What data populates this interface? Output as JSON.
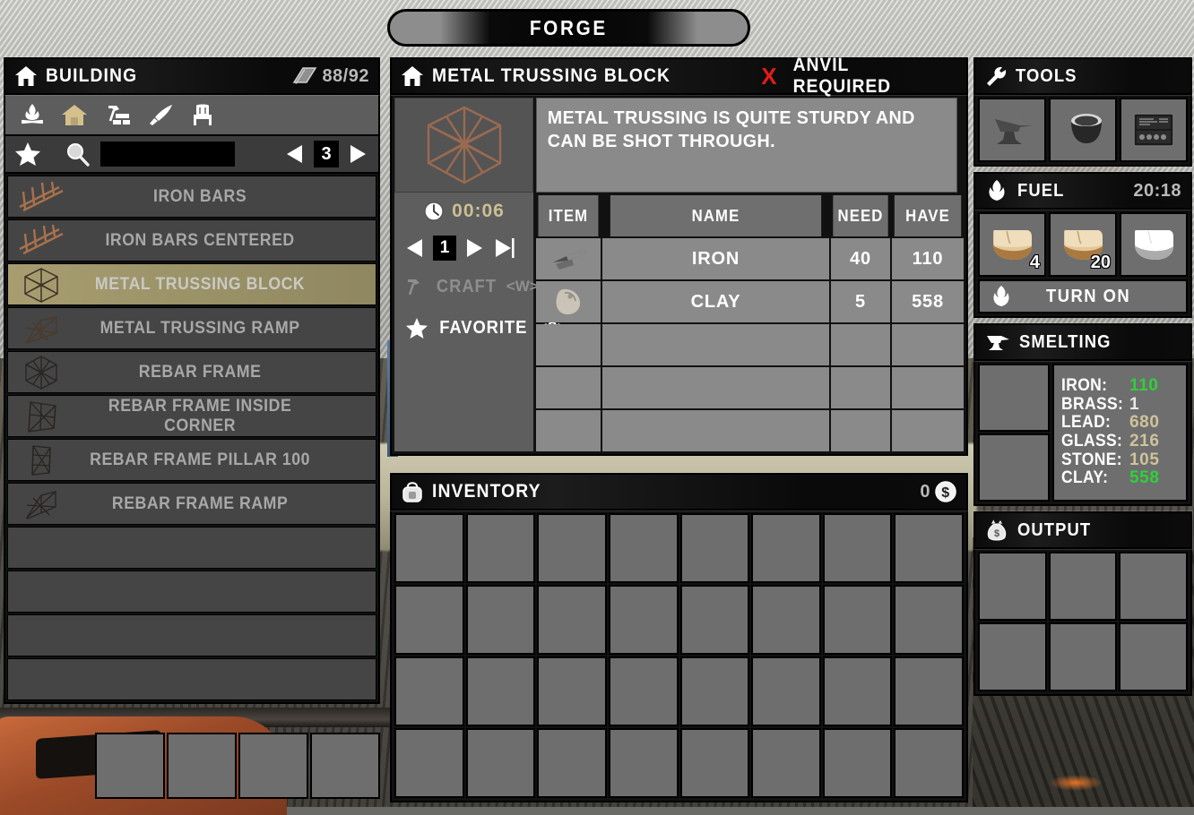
{
  "window": {
    "title": "FORGE"
  },
  "building": {
    "title": "BUILDING",
    "icon": "house-icon",
    "known_count": "88/92",
    "counter_icon": "book-icon",
    "categories": [
      {
        "name": "campfire-icon",
        "label": "Campfire",
        "selected": false
      },
      {
        "name": "house-icon",
        "label": "Building",
        "selected": true
      },
      {
        "name": "hammer-bricks-icon",
        "label": "Tools",
        "selected": false
      },
      {
        "name": "knife-icon",
        "label": "Weapons",
        "selected": false
      },
      {
        "name": "chair-icon",
        "label": "Furniture",
        "selected": false
      }
    ],
    "favorite_icon": "star-icon",
    "search_icon": "search-icon",
    "search_value": "",
    "search_placeholder": "",
    "page_prev_icon": "triangle-left-icon",
    "page_next_icon": "triangle-right-icon",
    "page_number": "3",
    "recipes": [
      {
        "label": "IRON BARS",
        "icon": "iron-bars-icon",
        "selected": false
      },
      {
        "label": "IRON BARS CENTERED",
        "icon": "iron-bars-centered-icon",
        "selected": false
      },
      {
        "label": "METAL TRUSSING BLOCK",
        "icon": "metal-trussing-block-icon",
        "selected": true
      },
      {
        "label": "METAL TRUSSING RAMP",
        "icon": "metal-trussing-ramp-icon",
        "selected": false
      },
      {
        "label": "REBAR FRAME",
        "icon": "rebar-frame-icon",
        "selected": false
      },
      {
        "label": "REBAR FRAME INSIDE CORNER",
        "icon": "rebar-frame-inside-corner-icon",
        "selected": false
      },
      {
        "label": "REBAR FRAME PILLAR 100",
        "icon": "rebar-frame-pillar-icon",
        "selected": false
      },
      {
        "label": "REBAR FRAME RAMP",
        "icon": "rebar-frame-ramp-icon",
        "selected": false
      }
    ],
    "empty_row_count": 4
  },
  "toolbelt": {
    "slot_count": 4
  },
  "detail": {
    "title": "METAL TRUSSING BLOCK",
    "icon": "house-icon",
    "requirement_mark": "X",
    "requirement_text": "ANVIL REQUIRED",
    "description": "METAL TRUSSING IS QUITE STURDY AND CAN BE SHOT THROUGH.",
    "preview_icon": "metal-trussing-block-icon",
    "craft_time_icon": "clock-icon",
    "craft_time": "00:06",
    "qty_prev_icon": "triangle-left-icon",
    "qty_value": "1",
    "qty_next_icon": "triangle-right-icon",
    "qty_max_icon": "triangle-right-bar-icon",
    "craft": {
      "label": "CRAFT",
      "key": "<W>",
      "icon": "hammer-icon",
      "enabled": false
    },
    "favorite": {
      "label": "FAVORITE",
      "key": "<S>",
      "icon": "star-icon",
      "enabled": true
    },
    "table": {
      "headers": [
        "ITEM",
        "NAME",
        "NEED",
        "HAVE"
      ],
      "rows": [
        {
          "icon": "iron-icon",
          "name": "IRON",
          "need": "40",
          "have": "110"
        },
        {
          "icon": "clay-icon",
          "name": "CLAY",
          "need": "5",
          "have": "558"
        }
      ],
      "empty_row_count": 3
    }
  },
  "inventory": {
    "title": "INVENTORY",
    "icon": "backpack-icon",
    "money": "0",
    "money_icon": "coin-icon",
    "columns": 8,
    "rows": 4
  },
  "tools": {
    "title": "TOOLS",
    "icon": "wrench-icon",
    "slots": [
      {
        "icon": "anvil-icon",
        "label": "Anvil"
      },
      {
        "icon": "crucible-icon",
        "label": "Crucible"
      },
      {
        "icon": "tool-kit-icon",
        "label": "Tool Kit"
      }
    ]
  },
  "fuel": {
    "title": "FUEL",
    "icon": "flame-icon",
    "time": "20:18",
    "slots": [
      {
        "icon": "wood-icon",
        "count": "4",
        "dim": false
      },
      {
        "icon": "wood-icon",
        "count": "20",
        "dim": false
      },
      {
        "icon": "wood-icon",
        "count": "",
        "dim": true
      }
    ],
    "turn_on": {
      "label": "TURN ON",
      "icon": "flame-icon"
    }
  },
  "smelting": {
    "title": "SMELTING",
    "icon": "anvil-icon",
    "slot_count": 2,
    "stats": [
      {
        "key": "IRON:",
        "value": "110",
        "color": "#2fd03a"
      },
      {
        "key": "BRASS:",
        "value": "1",
        "color": "#e8e8e8"
      },
      {
        "key": "LEAD:",
        "value": "680",
        "color": "#cfc39a"
      },
      {
        "key": "GLASS:",
        "value": "216",
        "color": "#cfc39a"
      },
      {
        "key": "STONE:",
        "value": "105",
        "color": "#cfc39a"
      },
      {
        "key": "CLAY:",
        "value": "558",
        "color": "#2fd03a"
      }
    ]
  },
  "output": {
    "title": "OUTPUT",
    "icon": "money-bag-icon",
    "columns": 3,
    "rows": 2
  }
}
